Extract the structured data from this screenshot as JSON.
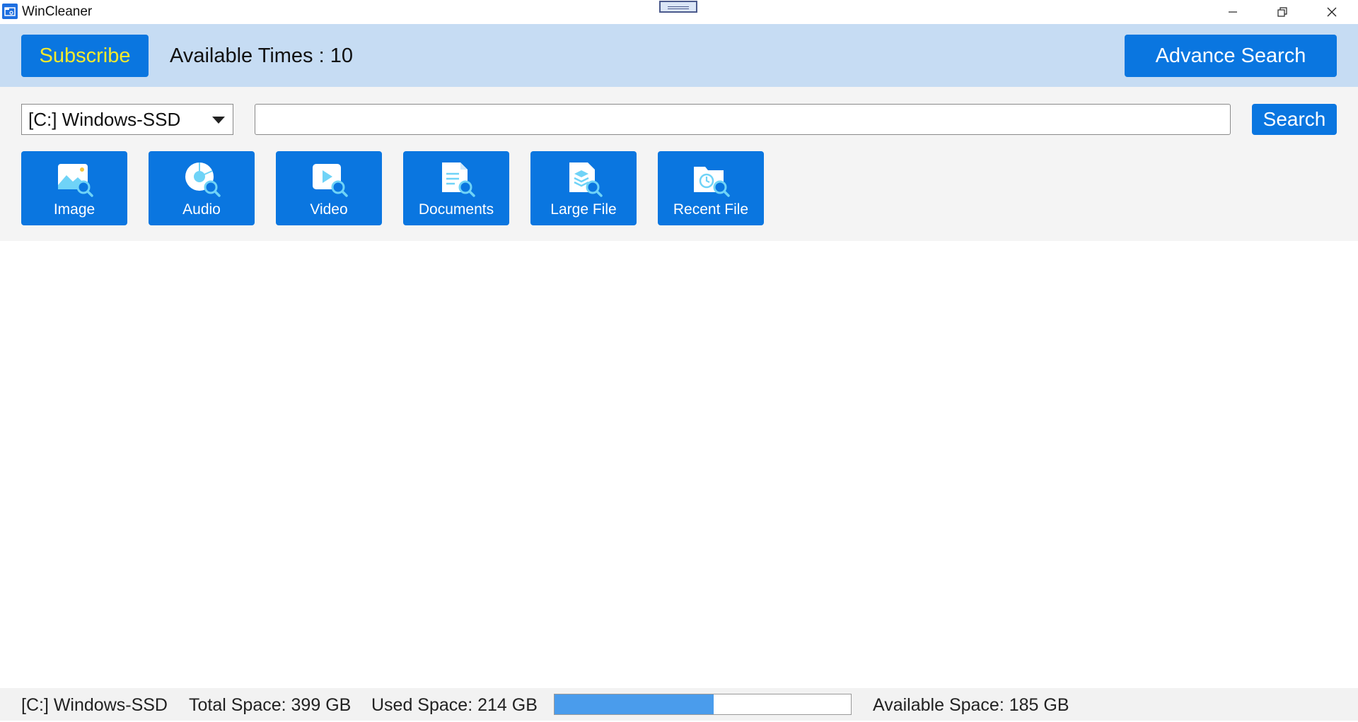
{
  "window": {
    "title": "WinCleaner",
    "controls": [
      "minimize-icon",
      "restore-icon",
      "close-icon"
    ]
  },
  "header": {
    "subscribe_label": "Subscribe",
    "available_times": "Available Times : 10",
    "advance_search_label": "Advance Search"
  },
  "search": {
    "drive_selected": "[C:] Windows-SSD",
    "query": "",
    "search_label": "Search"
  },
  "categories": [
    {
      "label": "Image",
      "icon": "image-search-icon"
    },
    {
      "label": "Audio",
      "icon": "audio-search-icon"
    },
    {
      "label": "Video",
      "icon": "video-search-icon"
    },
    {
      "label": "Documents",
      "icon": "document-search-icon"
    },
    {
      "label": "Large File",
      "icon": "large-file-search-icon"
    },
    {
      "label": "Recent File",
      "icon": "recent-file-search-icon"
    }
  ],
  "status": {
    "drive": "[C:] Windows-SSD",
    "total_space": "Total Space: 399 GB",
    "used_space": "Used Space: 214 GB",
    "available_space": "Available Space: 185 GB",
    "used_fraction": 0.536
  },
  "colors": {
    "accent": "#0a76e0",
    "header_band": "#c6dcf3",
    "subscribe_text": "#f5ea2c",
    "progress_fill": "#4a9cec",
    "icon_light": "#6fd3f7"
  }
}
